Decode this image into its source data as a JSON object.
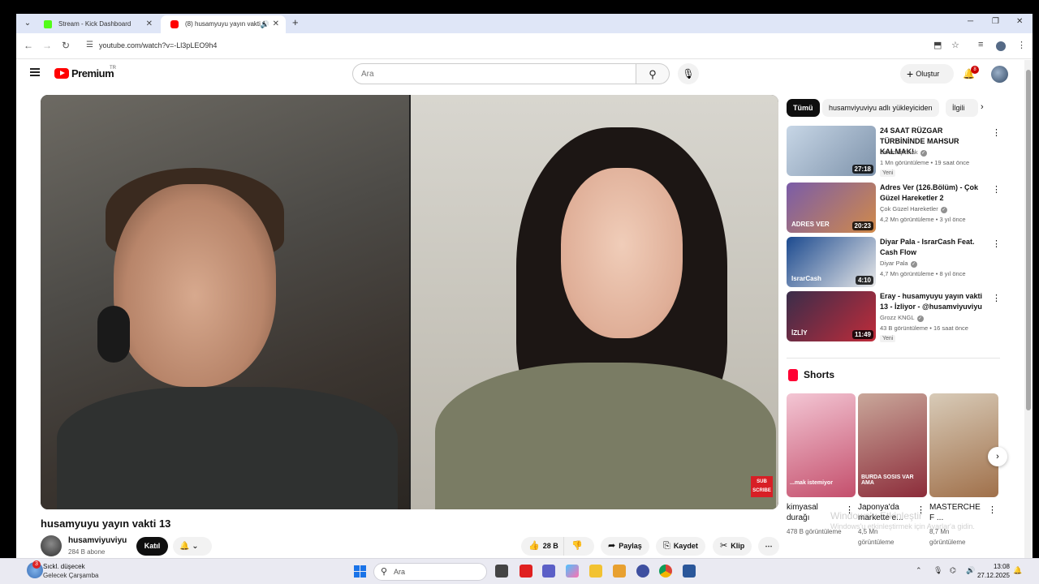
{
  "browser": {
    "tabs": [
      {
        "title": "Stream - Kick Dashboard"
      },
      {
        "title": "(8) husamyuyu yayın vakti 1"
      }
    ],
    "url": "youtube.com/watch?v=-Ll3pLEO9h4"
  },
  "youtube": {
    "logo": "Premium",
    "logo_sup": "TR",
    "search_placeholder": "Ara",
    "create_label": "Oluştur",
    "notifications": "8"
  },
  "video": {
    "title": "husamyuyu yayın vakti 13",
    "channel": "husamviyuviyu",
    "subscribers": "284 B abone",
    "join": "Katıl",
    "likes": "28 B",
    "share": "Paylaş",
    "save": "Kaydet",
    "clip": "Klip",
    "sub_badge": "SUB SCRIBE"
  },
  "chips": [
    "Tümü",
    "husamviyuviyu adlı yükleyiciden",
    "İlgili"
  ],
  "recommendations": [
    {
      "title": "24 SAAT RÜZGAR TÜRBİNİNDE MAHSUR KALMAK!",
      "channel": "Orkun Işıtmak",
      "meta": "1 Mn görüntüleme • 19 saat önce",
      "badge": "Yeni",
      "duration": "27:18",
      "colors": [
        "#c7d6e6",
        "#7e93ab"
      ]
    },
    {
      "title": "Adres Ver (126.Bölüm) - Çok Güzel Hareketler 2",
      "channel": "Çok Güzel Hareketler",
      "meta": "4,2 Mn görüntüleme • 3 yıl önce",
      "badge": "",
      "duration": "20:23",
      "colors": [
        "#7a5ca8",
        "#d18a4a"
      ],
      "thumb_text": "ADRES VER"
    },
    {
      "title": "Diyar Pala - IsrarCash Feat. Cash Flow",
      "channel": "Diyar Pala",
      "meta": "4,7 Mn görüntüleme • 8 yıl önce",
      "badge": "",
      "duration": "4:10",
      "colors": [
        "#1c4a8f",
        "#e8e8e8"
      ],
      "thumb_text": "IsrarCash"
    },
    {
      "title": "Eray - husamyuyu yayın vakti 13 - İzliyor - @husamviyuviyu",
      "channel": "Grozz KNGL",
      "meta": "43 B görüntüleme • 16 saat önce",
      "badge": "Yeni",
      "duration": "11:49",
      "colors": [
        "#3a2d4a",
        "#c02b3a"
      ],
      "thumb_text": "İZLİY"
    }
  ],
  "shorts": {
    "title": "Shorts",
    "items": [
      {
        "title": "kimyasal durağı",
        "views": "478 B görüntüleme",
        "colors": [
          "#f3c6d4",
          "#c44f6c"
        ],
        "caption": "...mak istemiyor"
      },
      {
        "title": "Japonya'da markette e...",
        "views": "4,5 Mn görüntüleme",
        "colors": [
          "#c9a79a",
          "#8c2c3a"
        ],
        "caption": "BURDA SOSIS VAR AMA"
      },
      {
        "title": "MASTERCHE F ...",
        "views": "8,7 Mn görüntüleme",
        "colors": [
          "#d8cbb8",
          "#a0704a"
        ],
        "caption": ""
      }
    ]
  },
  "watermark": {
    "line1": "Windows'u Etkinleştir",
    "line2": "Windows'u etkinleştirmek için Ayarlar'a gidin."
  },
  "taskbar": {
    "weather_badge": "3",
    "weather_line1": "Sıckl. düşecek",
    "weather_line2": "Gelecek Çarşamba",
    "search": "Ara",
    "time": "13:08",
    "date": "27.12.2025"
  }
}
